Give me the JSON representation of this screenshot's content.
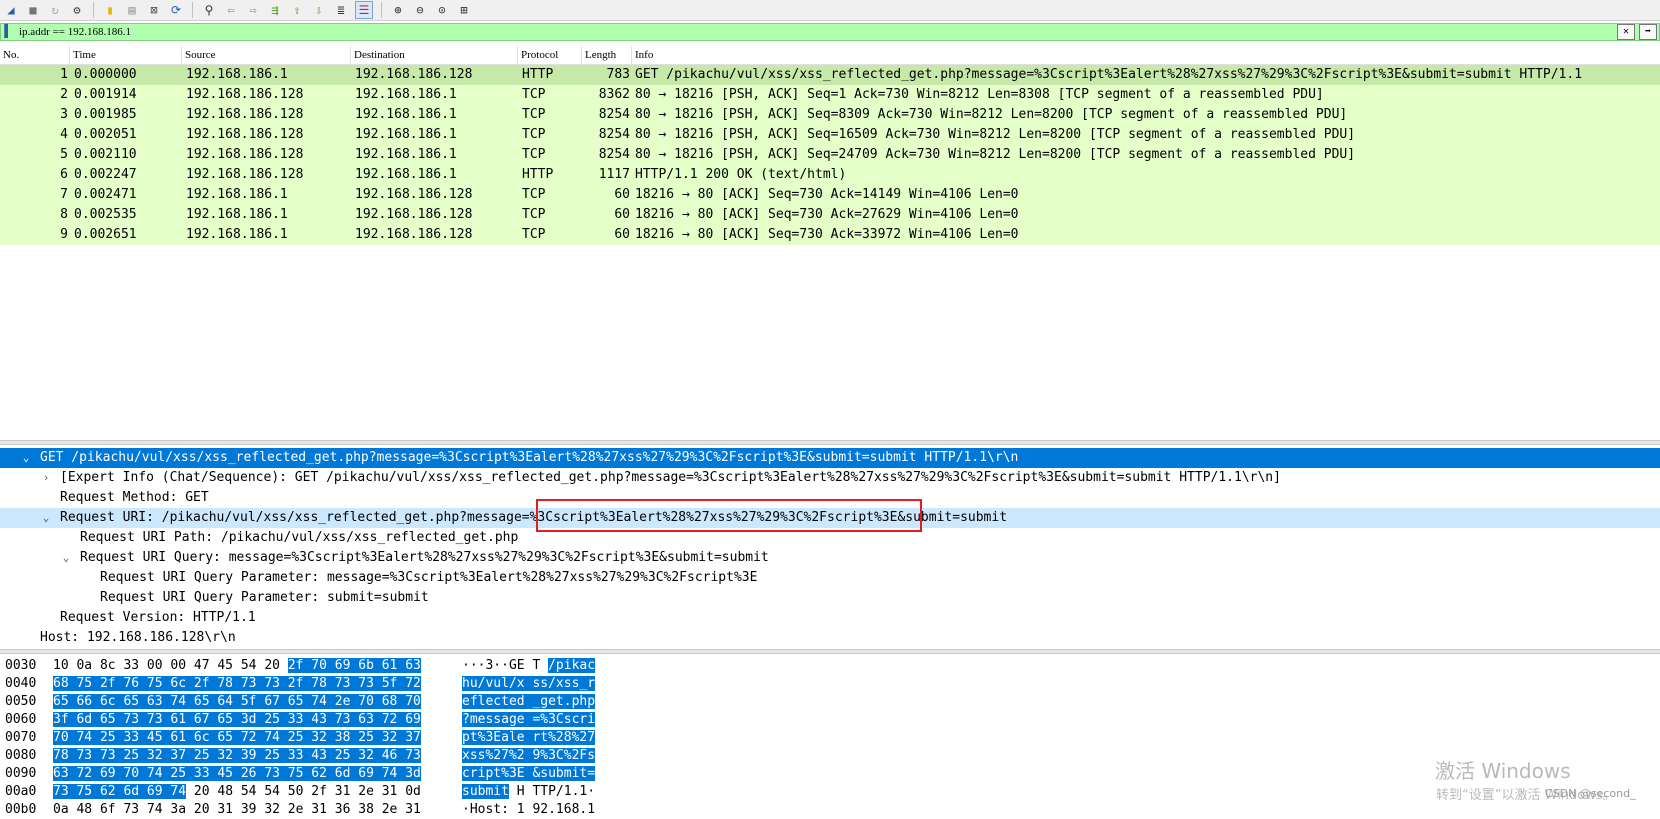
{
  "toolbar": {
    "icons": [
      "shark-fin-icon",
      "stop-icon",
      "restart-icon",
      "options-icon",
      "open-file-icon",
      "save-icon",
      "close-file-icon",
      "reload-icon",
      "find-icon",
      "back-icon",
      "forward-icon",
      "go-to-packet-icon",
      "first-packet-icon",
      "last-packet-icon",
      "autoscroll-icon",
      "colorize-icon",
      "zoom-in-icon",
      "zoom-out-icon",
      "normal-size-icon",
      "resize-columns-icon"
    ]
  },
  "filter": {
    "value": "ip.addr == 192.168.186.1"
  },
  "columns": {
    "no": "No.",
    "time": "Time",
    "source": "Source",
    "destination": "Destination",
    "protocol": "Protocol",
    "length": "Length",
    "info": "Info"
  },
  "packets": [
    {
      "no": "1",
      "time": "0.000000",
      "src": "192.168.186.1",
      "dst": "192.168.186.128",
      "proto": "HTTP",
      "len": "783",
      "info": "GET /pikachu/vul/xss/xss_reflected_get.php?message=%3Cscript%3Ealert%28%27xss%27%29%3C%2Fscript%3E&submit=submit HTTP/1.1"
    },
    {
      "no": "2",
      "time": "0.001914",
      "src": "192.168.186.128",
      "dst": "192.168.186.1",
      "proto": "TCP",
      "len": "8362",
      "info": "80 → 18216 [PSH, ACK] Seq=1 Ack=730 Win=8212 Len=8308 [TCP segment of a reassembled PDU]"
    },
    {
      "no": "3",
      "time": "0.001985",
      "src": "192.168.186.128",
      "dst": "192.168.186.1",
      "proto": "TCP",
      "len": "8254",
      "info": "80 → 18216 [PSH, ACK] Seq=8309 Ack=730 Win=8212 Len=8200 [TCP segment of a reassembled PDU]"
    },
    {
      "no": "4",
      "time": "0.002051",
      "src": "192.168.186.128",
      "dst": "192.168.186.1",
      "proto": "TCP",
      "len": "8254",
      "info": "80 → 18216 [PSH, ACK] Seq=16509 Ack=730 Win=8212 Len=8200 [TCP segment of a reassembled PDU]"
    },
    {
      "no": "5",
      "time": "0.002110",
      "src": "192.168.186.128",
      "dst": "192.168.186.1",
      "proto": "TCP",
      "len": "8254",
      "info": "80 → 18216 [PSH, ACK] Seq=24709 Ack=730 Win=8212 Len=8200 [TCP segment of a reassembled PDU]"
    },
    {
      "no": "6",
      "time": "0.002247",
      "src": "192.168.186.128",
      "dst": "192.168.186.1",
      "proto": "HTTP",
      "len": "1117",
      "info": "HTTP/1.1 200 OK  (text/html)"
    },
    {
      "no": "7",
      "time": "0.002471",
      "src": "192.168.186.1",
      "dst": "192.168.186.128",
      "proto": "TCP",
      "len": "60",
      "info": "18216 → 80 [ACK] Seq=730 Ack=14149 Win=4106 Len=0"
    },
    {
      "no": "8",
      "time": "0.002535",
      "src": "192.168.186.1",
      "dst": "192.168.186.128",
      "proto": "TCP",
      "len": "60",
      "info": "18216 → 80 [ACK] Seq=730 Ack=27629 Win=4106 Len=0"
    },
    {
      "no": "9",
      "time": "0.002651",
      "src": "192.168.186.1",
      "dst": "192.168.186.128",
      "proto": "TCP",
      "len": "60",
      "info": "18216 → 80 [ACK] Seq=730 Ack=33972 Win=4106 Len=0"
    }
  ],
  "details": {
    "request_line": "GET /pikachu/vul/xss/xss_reflected_get.php?message=%3Cscript%3Ealert%28%27xss%27%29%3C%2Fscript%3E&submit=submit HTTP/1.1\\r\\n",
    "expert_info": "[Expert Info (Chat/Sequence): GET /pikachu/vul/xss/xss_reflected_get.php?message=%3Cscript%3Ealert%28%27xss%27%29%3C%2Fscript%3E&submit=submit HTTP/1.1\\r\\n]",
    "method": "Request Method: GET",
    "uri": "Request URI: /pikachu/vul/xss/xss_reflected_get.php?message=%3Cscript%3Ealert%28%27xss%27%29%3C%2Fscript%3E&submit=submit",
    "uri_path": "Request URI Path: /pikachu/vul/xss/xss_reflected_get.php",
    "uri_query": "Request URI Query: message=%3Cscript%3Ealert%28%27xss%27%29%3C%2Fscript%3E&submit=submit",
    "param1": "Request URI Query Parameter: message=%3Cscript%3Ealert%28%27xss%27%29%3C%2Fscript%3E",
    "param2": "Request URI Query Parameter: submit=submit",
    "version": "Request Version: HTTP/1.1",
    "host": "Host: 192.168.186.128\\r\\n"
  },
  "bytes": [
    {
      "off": "0030",
      "hex_plain": "10 0a 8c 33 00 00 47 45  54 20 ",
      "hex_hl": "2f 70 69 6b 61 63",
      "ascii_plain": "···3··GE T ",
      "ascii_hl": "/pikac"
    },
    {
      "off": "0040",
      "hex_plain": "",
      "hex_hl": "68 75 2f 76 75 6c 2f 78  73 73 2f 78 73 73 5f 72",
      "ascii_plain": "",
      "ascii_hl": "hu/vul/x ss/xss_r"
    },
    {
      "off": "0050",
      "hex_plain": "",
      "hex_hl": "65 66 6c 65 63 74 65 64  5f 67 65 74 2e 70 68 70",
      "ascii_plain": "",
      "ascii_hl": "eflected _get.php"
    },
    {
      "off": "0060",
      "hex_plain": "",
      "hex_hl": "3f 6d 65 73 73 61 67 65  3d 25 33 43 73 63 72 69",
      "ascii_plain": "",
      "ascii_hl": "?message =%3Cscri"
    },
    {
      "off": "0070",
      "hex_plain": "",
      "hex_hl": "70 74 25 33 45 61 6c 65  72 74 25 32 38 25 32 37",
      "ascii_plain": "",
      "ascii_hl": "pt%3Eale rt%28%27"
    },
    {
      "off": "0080",
      "hex_plain": "",
      "hex_hl": "78 73 73 25 32 37 25 32  39 25 33 43 25 32 46 73",
      "ascii_plain": "",
      "ascii_hl": "xss%27%2 9%3C%2Fs"
    },
    {
      "off": "0090",
      "hex_plain": "",
      "hex_hl": "63 72 69 70 74 25 33 45  26 73 75 62 6d 69 74 3d",
      "ascii_plain": "",
      "ascii_hl": "cript%3E &submit="
    },
    {
      "off": "00a0",
      "hex_plain_after": " 20 48  54 54 50 2f 31 2e 31 0d",
      "hex_hl": "73 75 62 6d 69 74",
      "ascii_hl": "submit",
      "ascii_plain_after": " H TTP/1.1·"
    },
    {
      "off": "00b0",
      "hex_plain": "0a 48 6f 73 74 3a 20 31  39 32 2e 31 36 38 2e 31",
      "hex_hl": "",
      "ascii_plain": "·Host: 1 92.168.1",
      "ascii_hl": ""
    }
  ],
  "watermark": {
    "title": "激活 Windows",
    "subtitle": "转到“设置”以激活 Windows。",
    "csdn": "CSDN @second_"
  }
}
